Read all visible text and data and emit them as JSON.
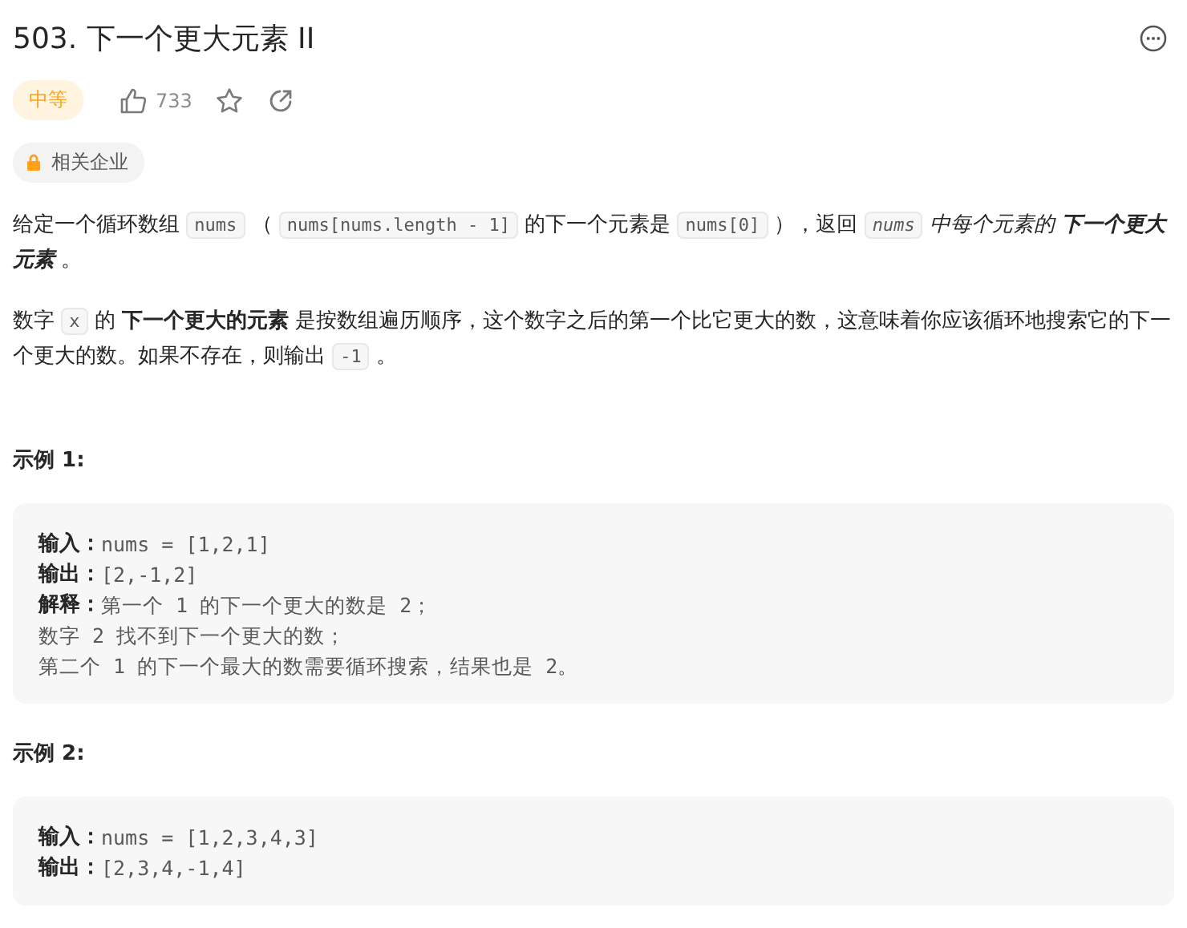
{
  "title": "503. 下一个更大元素 II",
  "difficulty": "中等",
  "likes": "733",
  "company_tag": "相关企业",
  "paragraphs": [
    [
      {
        "kind": "text",
        "text": "给定一个循环数组 "
      },
      {
        "kind": "code",
        "text": "nums"
      },
      {
        "kind": "text",
        "text": " （ "
      },
      {
        "kind": "code",
        "text": "nums[nums.length - 1]"
      },
      {
        "kind": "text",
        "text": " 的下一个元素是 "
      },
      {
        "kind": "code",
        "text": "nums[0]"
      },
      {
        "kind": "text",
        "text": " ），返回 "
      },
      {
        "kind": "code_em",
        "text": "nums"
      },
      {
        "kind": "em",
        "text": " 中每个元素的 "
      },
      {
        "kind": "em_strong",
        "text": "下一个更大元素"
      },
      {
        "kind": "text",
        "text": " 。"
      }
    ],
    [
      {
        "kind": "text",
        "text": "数字 "
      },
      {
        "kind": "code",
        "text": "x"
      },
      {
        "kind": "text",
        "text": " 的 "
      },
      {
        "kind": "strong",
        "text": "下一个更大的元素"
      },
      {
        "kind": "text",
        "text": " 是按数组遍历顺序，这个数字之后的第一个比它更大的数，这意味着你应该循环地搜索它的下一个更大的数。如果不存在，则输出 "
      },
      {
        "kind": "code",
        "text": "-1"
      },
      {
        "kind": "text",
        "text": " 。"
      }
    ]
  ],
  "examples": [
    {
      "heading": "示例 1:",
      "lines": [
        {
          "label": "输入：",
          "value": "nums = [1,2,1]"
        },
        {
          "label": "输出：",
          "value": "[2,-1,2]"
        },
        {
          "label": "解释：",
          "value": "第一个 1 的下一个更大的数是 2；"
        },
        {
          "value": "数字 2 找不到下一个更大的数；"
        },
        {
          "value": "第二个 1 的下一个最大的数需要循环搜索，结果也是 2。"
        }
      ]
    },
    {
      "heading": "示例 2:",
      "lines": [
        {
          "label": "输入：",
          "value": "nums = [1,2,3,4,3]"
        },
        {
          "label": "输出：",
          "value": "[2,3,4,-1,4]"
        }
      ]
    }
  ]
}
